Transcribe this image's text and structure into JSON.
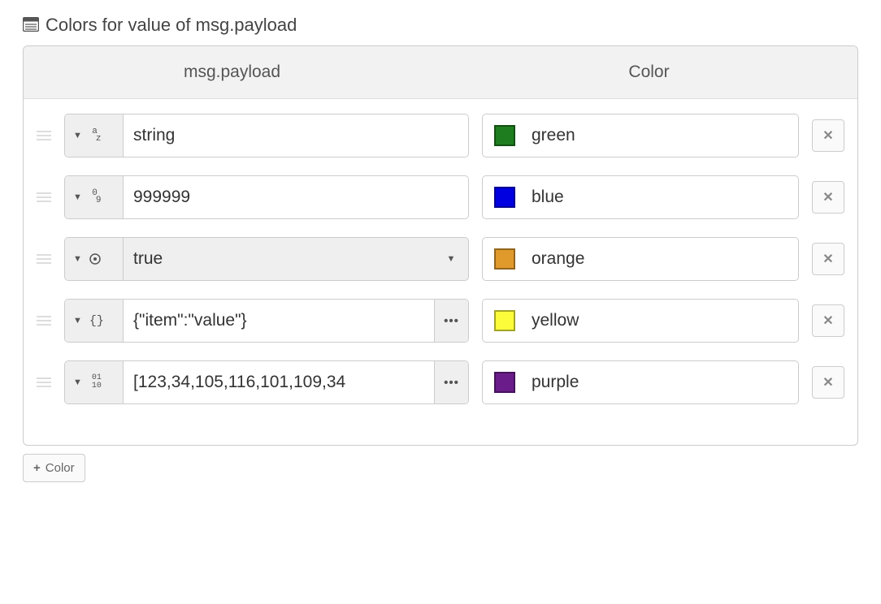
{
  "section": {
    "title": "Colors for value of msg.payload"
  },
  "headers": {
    "payload": "msg.payload",
    "color": "Color"
  },
  "rows": [
    {
      "type": "string",
      "type_icon": "az",
      "value": "string",
      "color_name": "green",
      "color_hex": "#1e7d1e"
    },
    {
      "type": "number",
      "type_icon": "09",
      "value": "999999",
      "color_name": "blue",
      "color_hex": "#0000e0"
    },
    {
      "type": "boolean",
      "type_icon": "bool",
      "value": "true",
      "color_name": "orange",
      "color_hex": "#e09a2c"
    },
    {
      "type": "json",
      "type_icon": "braces",
      "value": "{\"item\":\"value\"}",
      "color_name": "yellow",
      "color_hex": "#fcfc3a"
    },
    {
      "type": "buffer",
      "type_icon": "bin",
      "value": "[123,34,105,116,101,109,34",
      "color_name": "purple",
      "color_hex": "#6a1d8a"
    }
  ],
  "add_button": "Color"
}
